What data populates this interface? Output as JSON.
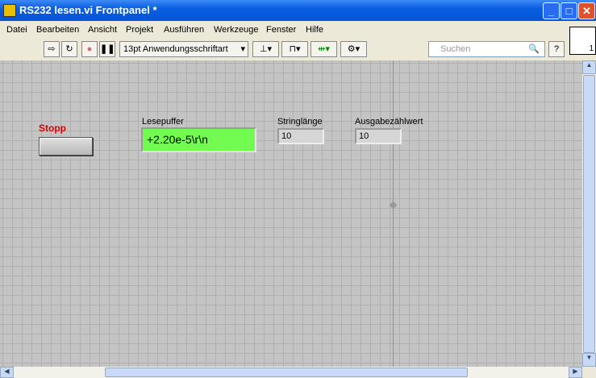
{
  "window": {
    "title": "RS232 lesen.vi Frontpanel *"
  },
  "menu": [
    "Datei",
    "Bearbeiten",
    "Ansicht",
    "Projekt",
    "Ausführen",
    "Werkzeuge",
    "Fenster",
    "Hilfe"
  ],
  "toolbar": {
    "font": "13pt Anwendungsschriftart",
    "search_placeholder": "Suchen",
    "help": "?"
  },
  "vi_icon": {
    "number": "1"
  },
  "controls": {
    "stopp": {
      "label": "Stopp"
    },
    "lesepuffer": {
      "label": "Lesepuffer",
      "value": "+2.20e-5\\r\\n"
    },
    "stringlaenge": {
      "label": "Stringlänge",
      "value": "10"
    },
    "ausgabe": {
      "label": "Ausgabezählwert",
      "value": "10"
    }
  },
  "colors": {
    "indicator_green": "#72fc52",
    "stop_label": "#e00000"
  }
}
